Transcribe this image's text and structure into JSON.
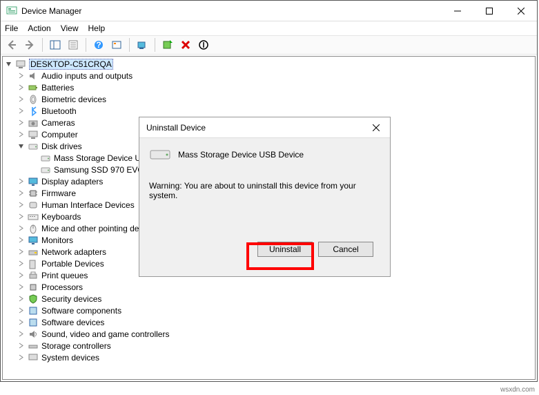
{
  "window": {
    "title": "Device Manager",
    "menus": [
      "File",
      "Action",
      "View",
      "Help"
    ]
  },
  "tree": {
    "root": "DESKTOP-C51CRQA",
    "items": [
      {
        "label": "Audio inputs and outputs"
      },
      {
        "label": "Batteries"
      },
      {
        "label": "Biometric devices"
      },
      {
        "label": "Bluetooth"
      },
      {
        "label": "Cameras"
      },
      {
        "label": "Computer"
      },
      {
        "label": "Disk drives",
        "expanded": true,
        "children": [
          {
            "label": "Mass Storage Device USB Device"
          },
          {
            "label": "Samsung SSD 970 EVO Plus"
          }
        ]
      },
      {
        "label": "Display adapters"
      },
      {
        "label": "Firmware"
      },
      {
        "label": "Human Interface Devices"
      },
      {
        "label": "Keyboards"
      },
      {
        "label": "Mice and other pointing devices"
      },
      {
        "label": "Monitors"
      },
      {
        "label": "Network adapters"
      },
      {
        "label": "Portable Devices"
      },
      {
        "label": "Print queues"
      },
      {
        "label": "Processors"
      },
      {
        "label": "Security devices"
      },
      {
        "label": "Software components"
      },
      {
        "label": "Software devices"
      },
      {
        "label": "Sound, video and game controllers"
      },
      {
        "label": "Storage controllers"
      },
      {
        "label": "System devices"
      }
    ]
  },
  "dialog": {
    "title": "Uninstall Device",
    "device": "Mass Storage Device USB Device",
    "warning": "Warning: You are about to uninstall this device from your system.",
    "uninstall": "Uninstall",
    "cancel": "Cancel"
  },
  "watermark": "wsxdn.com"
}
